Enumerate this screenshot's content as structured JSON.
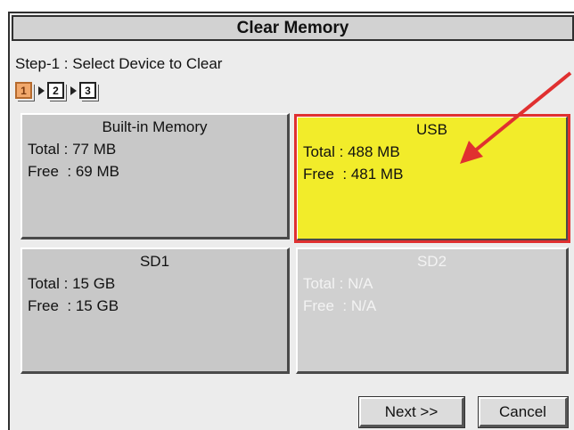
{
  "window": {
    "title": "Clear Memory"
  },
  "step": {
    "label": "Step-1 : Select Device to Clear",
    "indicators": [
      "1",
      "2",
      "3"
    ],
    "active": 1
  },
  "devices": [
    {
      "name": "Built-in Memory",
      "total": "Total : 77 MB",
      "free": "Free  : 69 MB",
      "state": "normal"
    },
    {
      "name": "USB",
      "total": "Total : 488 MB",
      "free": "Free  : 481 MB",
      "state": "selected"
    },
    {
      "name": "SD1",
      "total": "Total : 15 GB",
      "free": "Free  : 15 GB",
      "state": "normal"
    },
    {
      "name": "SD2",
      "total": "Total : N/A",
      "free": "Free  : N/A",
      "state": "disabled"
    }
  ],
  "buttons": {
    "next": "Next >>",
    "cancel": "Cancel"
  },
  "colors": {
    "selected_fill": "#f2ec2a",
    "annotation_arrow": "#e03030",
    "active_step": "#f1a86c"
  }
}
